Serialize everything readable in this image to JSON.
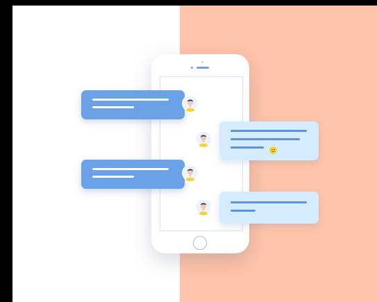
{
  "illustration": {
    "subject": "",
    "colors": {
      "background_left": "#ffffff",
      "background_right": "#ffc4a9",
      "frame": "#000000",
      "outgoing_bubble": "#6ba1e6",
      "incoming_bubble": "#d5ecff",
      "accent_text_lines": "#5b93e0",
      "avatar_shirt": "#f7d233"
    },
    "messages": [
      {
        "side": "left",
        "style": "outgoing",
        "icon": "user-avatar-icon"
      },
      {
        "side": "right",
        "style": "incoming",
        "icon": "user-avatar-icon",
        "emoji": "smiley-emoji-icon"
      },
      {
        "side": "left",
        "style": "outgoing",
        "icon": "user-avatar-icon"
      },
      {
        "side": "right",
        "style": "incoming",
        "icon": "user-avatar-icon"
      }
    ]
  }
}
